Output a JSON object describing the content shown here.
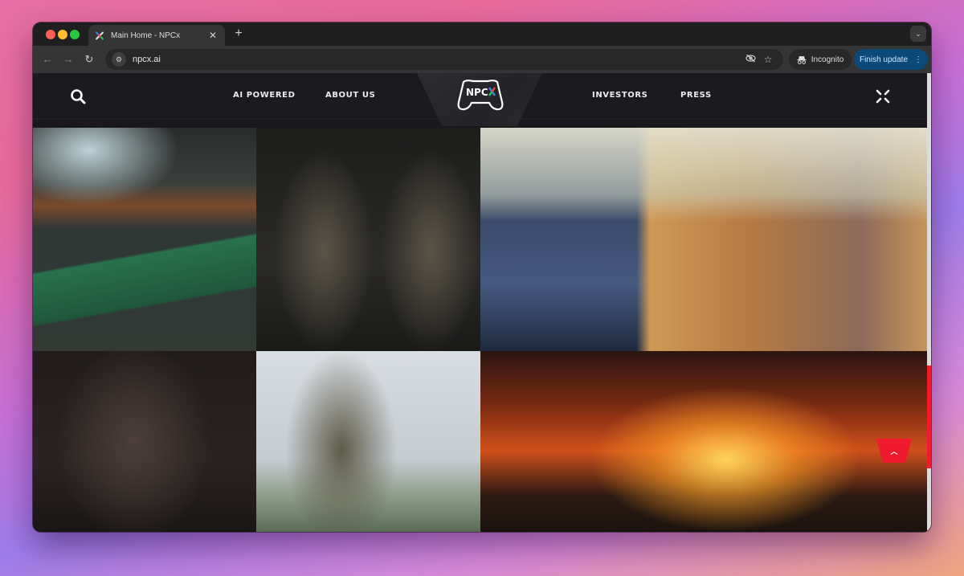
{
  "browser": {
    "tab": {
      "title": "Main Home - NPCx",
      "favicon": "npcx-x-icon",
      "close_glyph": "✕"
    },
    "new_tab_glyph": "+",
    "tab_search_glyph": "⌄",
    "nav": {
      "back_glyph": "←",
      "forward_glyph": "→",
      "reload_glyph": "↻"
    },
    "address": {
      "url": "npcx.ai",
      "site_info_glyph": "⚙"
    },
    "omnibox_icons": {
      "eye_off_glyph": "◎",
      "star_glyph": "☆"
    },
    "incognito_label": "Incognito",
    "finish_update_label": "Finish update",
    "menu_glyph": "⋮"
  },
  "site": {
    "brand": "NPCX",
    "nav_links": [
      "AI POWERED",
      "ABOUT US",
      "INVESTORS",
      "PRESS"
    ],
    "accent_color": "#ef1a2d",
    "scroll_top_glyph": "︿",
    "gallery": [
      {
        "alt": "Cyberpunk Asian street market with green awning and neon signs"
      },
      {
        "alt": "Two armored tactical soldiers in dark combat suits"
      },
      {
        "alt": "Bipedal robot walking past a sunlit wall in snow"
      },
      {
        "alt": "Hulking mutant creature beside an armored soldier"
      },
      {
        "alt": "Soldier in gas mask holding rifle with floating drone"
      },
      {
        "alt": "Soldiers advancing on a burning battlefield with a drone overhead"
      }
    ]
  }
}
